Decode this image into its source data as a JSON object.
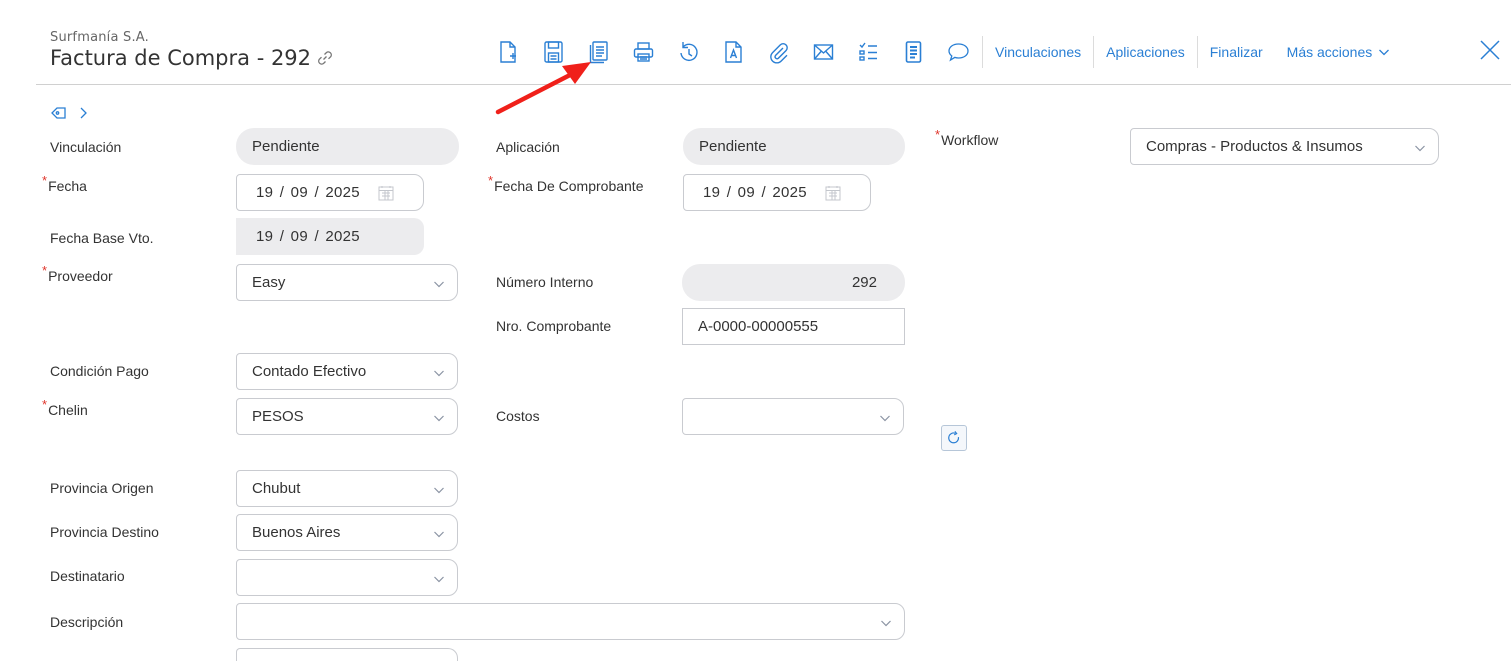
{
  "header": {
    "company": "Surfmanía S.A.",
    "title": "Factura de Compra - 292"
  },
  "toolbar": {
    "icons": [
      "new-document-icon",
      "save-icon",
      "copy-document-icon",
      "print-icon",
      "history-icon",
      "text-document-icon",
      "attachment-icon",
      "email-icon",
      "checklist-icon",
      "report-icon",
      "comment-icon"
    ],
    "vinculaciones": "Vinculaciones",
    "aplicaciones": "Aplicaciones",
    "finalizar": "Finalizar",
    "mas_acciones": "Más acciones"
  },
  "colors": {
    "accent": "#2a7fd4",
    "required": "#e0352b",
    "arrow": "#f0201a",
    "readonly_bg": "#ececee"
  },
  "form": {
    "vinculacion": {
      "label": "Vinculación",
      "value": "Pendiente"
    },
    "aplicacion": {
      "label": "Aplicación",
      "value": "Pendiente"
    },
    "workflow": {
      "label": "Workflow",
      "value": "Compras - Productos & Insumos"
    },
    "fecha": {
      "label": "Fecha",
      "value": "19 / 09 / 2025"
    },
    "fecha_comprobante": {
      "label": "Fecha De Comprobante",
      "value": "19 / 09 / 2025"
    },
    "fecha_base_vto": {
      "label": "Fecha Base Vto.",
      "value": "19 / 09 / 2025"
    },
    "proveedor": {
      "label": "Proveedor",
      "value": "Easy"
    },
    "numero_interno": {
      "label": "Número Interno",
      "value": "292"
    },
    "nro_comprobante": {
      "label": "Nro. Comprobante",
      "value": "A-0000-00000555"
    },
    "condicion_pago": {
      "label": "Condición Pago",
      "value": "Contado Efectivo"
    },
    "chelin": {
      "label": "Chelin",
      "value": "PESOS"
    },
    "costos": {
      "label": "Costos",
      "value": ""
    },
    "provincia_origen": {
      "label": "Provincia Origen",
      "value": "Chubut"
    },
    "provincia_destino": {
      "label": "Provincia Destino",
      "value": "Buenos Aires"
    },
    "destinatario": {
      "label": "Destinatario",
      "value": ""
    },
    "descripcion": {
      "label": "Descripción",
      "value": ""
    }
  }
}
